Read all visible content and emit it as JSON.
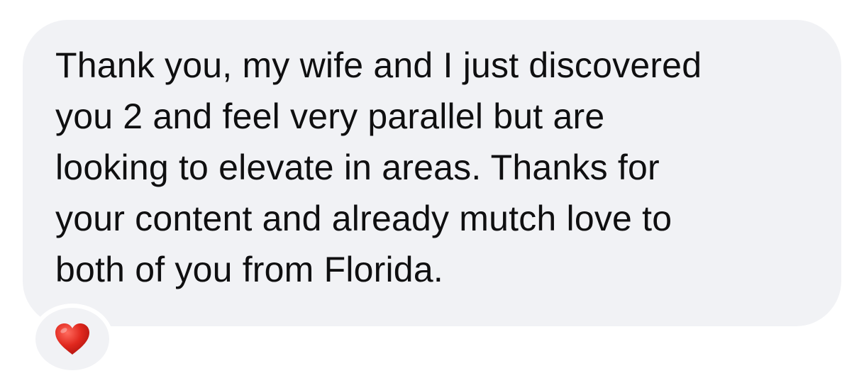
{
  "message": {
    "lines": [
      "Thank you, my wife and I just discovered",
      "you 2 and feel very parallel but are",
      "looking to elevate in areas. Thanks for",
      "your content and already mutch love to",
      "both of you from Florida."
    ],
    "bubble_color": "#f1f2f5",
    "text_color": "#0f0f10"
  },
  "reaction": {
    "icon": "red-heart-icon",
    "color": "#e0281e"
  }
}
